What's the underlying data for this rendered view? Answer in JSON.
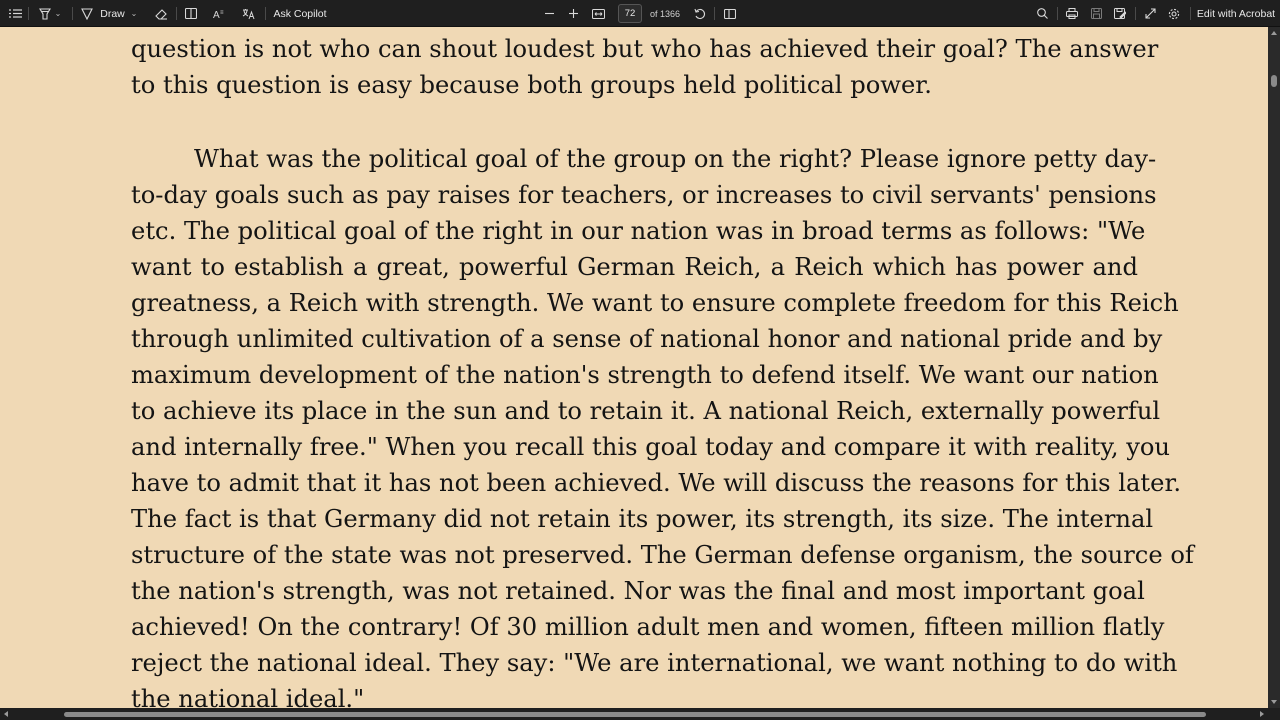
{
  "toolbar": {
    "draw_label": "Draw",
    "ask_copilot_label": "Ask Copilot",
    "page_number": "72",
    "page_total": "of 1366",
    "edit_label": "Edit with Acrobat"
  },
  "document": {
    "background_color": "#f0d9b5",
    "paragraph1_lines": [
      "question is not who can shout loudest but who has achieved their goal? The answer",
      "to this question is easy because both groups held political power."
    ],
    "paragraph2_lines": [
      "What was the political goal of the group on the right? Please ignore petty day-",
      "to-day goals such as pay raises for teachers, or increases to civil servants' pensions",
      "etc. The political goal of the right in our nation was in broad terms as follows: \"We",
      "want to establish a great, powerful German Reich, a Reich which has power and",
      "greatness, a Reich with strength. We want to ensure complete freedom for this Reich",
      "through unlimited cultivation of a sense of national honor and national pride and by",
      "maximum development of the nation's strength to defend itself. We want our nation",
      "to achieve its place in the sun and to retain it. A national Reich, externally powerful",
      "and internally free.\" When you recall this goal today and compare it with reality, you",
      "have to admit that it has not been achieved. We will discuss the reasons for this later.",
      "The fact is that Germany did not retain its power, its strength, its size. The internal",
      "structure of the state was not preserved. The German defense organism, the source of",
      "the nation's strength, was not retained. Nor was the final and most important goal",
      "achieved! On the contrary! Of 30 million adult men and women, fifteen million flatly",
      "reject the national ideal. They say: \"We are international, we want nothing to do with",
      "the national ideal.\""
    ]
  }
}
